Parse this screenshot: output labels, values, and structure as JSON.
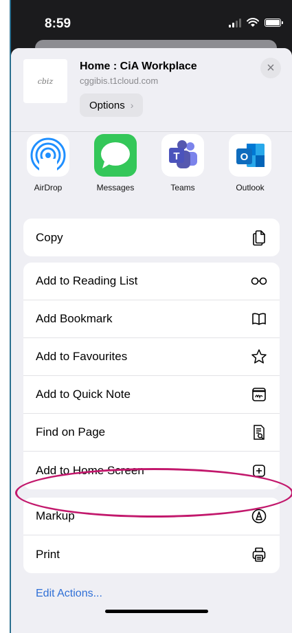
{
  "status": {
    "time": "8:59"
  },
  "share": {
    "title": "Home : CiA Workplace",
    "url": "cggibis.t1cloud.com",
    "options_label": "Options",
    "thumb_logo": "cbiz"
  },
  "apps": [
    {
      "label": "AirDrop",
      "icon": "airdrop-icon"
    },
    {
      "label": "Messages",
      "icon": "messages-icon"
    },
    {
      "label": "Teams",
      "icon": "teams-icon"
    },
    {
      "label": "Outlook",
      "icon": "outlook-icon"
    }
  ],
  "actions": {
    "copy": {
      "label": "Copy",
      "icon": "copy-icon"
    },
    "group2": [
      {
        "label": "Add to Reading List",
        "icon": "glasses-icon"
      },
      {
        "label": "Add Bookmark",
        "icon": "book-icon"
      },
      {
        "label": "Add to Favourites",
        "icon": "star-icon"
      },
      {
        "label": "Add to Quick Note",
        "icon": "quick-note-icon"
      },
      {
        "label": "Find on Page",
        "icon": "find-on-page-icon"
      },
      {
        "label": "Add to Home Screen",
        "icon": "plus-square-icon"
      }
    ],
    "group3": [
      {
        "label": "Markup",
        "icon": "markup-icon"
      },
      {
        "label": "Print",
        "icon": "printer-icon"
      }
    ],
    "edit_label": "Edit Actions..."
  },
  "colors": {
    "highlight": "#c2186c",
    "link_blue": "#2f6fd6",
    "messages_green": "#34c759",
    "teams_purple": "#5558af",
    "outlook_blue": "#0f6cbd"
  }
}
